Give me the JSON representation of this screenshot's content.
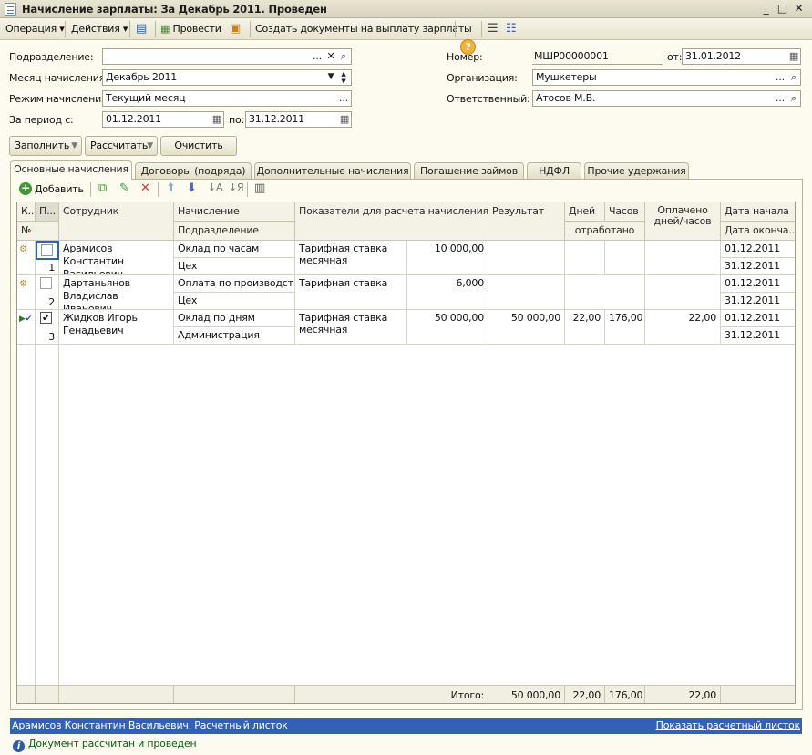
{
  "window": {
    "title": "Начисление зарплаты: За Декабрь 2011. Проведен"
  },
  "toolbar": {
    "operation": "Операция",
    "actions": "Действия",
    "post": "Провести",
    "create_payment": "Создать документы на выплату зарплаты"
  },
  "form": {
    "division_label": "Подразделение:",
    "division_value": "",
    "month_label": "Месяц начисления:",
    "month_value": "Декабрь 2011",
    "mode_label": "Режим начисления:",
    "mode_value": "Текущий месяц",
    "period_label": "За период с:",
    "period_from": "01.12.2011",
    "period_to_label": "по:",
    "period_to": "31.12.2011",
    "number_label": "Номер:",
    "number_value": "МШР00000001",
    "date_label": "от:",
    "date_value": "31.01.2012",
    "org_label": "Организация:",
    "org_value": "Мушкетеры",
    "resp_label": "Ответственный:",
    "resp_value": "Атосов М.В."
  },
  "commands": {
    "fill": "Заполнить",
    "calc": "Рассчитать",
    "clear": "Очистить"
  },
  "tabs": [
    "Основные начисления",
    "Договоры (подряда)",
    "Дополнительные начисления",
    "Погашение займов",
    "НДФЛ",
    "Прочие удержания"
  ],
  "grid_toolbar": {
    "add": "Добавить"
  },
  "columns": {
    "k": "К...",
    "p": "П...",
    "num": "№",
    "employee": "Сотрудник",
    "accrual": "Начисление",
    "division": "Подразделение",
    "indicators": "Показатели для расчета начисления",
    "result": "Результат",
    "days": "Дней",
    "hours": "Часов",
    "worked": "отработано",
    "paid": "Оплачено дней/часов",
    "start": "Дата начала",
    "end": "Дата оконча..."
  },
  "rows": [
    {
      "num": "1",
      "checked": "",
      "employee": "Арамисов Константин Васильевич",
      "accrual": "Оклад по часам",
      "division": "Цех",
      "indicator": "Тарифная ставка месячная",
      "ind_value": "10 000,00",
      "result": "",
      "days": "",
      "hours": "",
      "paid": "",
      "start": "01.12.2011",
      "end": "31.12.2011"
    },
    {
      "num": "2",
      "checked": "",
      "employee": "Дартаньянов Владислав Иванович",
      "accrual": "Оплата по производст...",
      "division": "Цех",
      "indicator": "Тарифная ставка",
      "ind_value": "6,000",
      "result": "",
      "days": "",
      "hours": "",
      "paid": "",
      "start": "01.12.2011",
      "end": "31.12.2011"
    },
    {
      "num": "3",
      "checked": "✔",
      "employee": "Жидков Игорь Генадьевич",
      "accrual": "Оклад по дням",
      "division": "Администрация",
      "indicator": "Тарифная ставка месячная",
      "ind_value": "50 000,00",
      "result": "50 000,00",
      "days": "22,00",
      "hours": "176,00",
      "paid": "22,00",
      "start": "01.12.2011",
      "end": "31.12.2011"
    }
  ],
  "footer": {
    "total_label": "Итого:",
    "result": "50 000,00",
    "days": "22,00",
    "hours": "176,00",
    "paid": "22,00"
  },
  "status": {
    "text": "Арамисов Константин Васильевич. Расчетный листок",
    "link": "Показать расчетный листок",
    "info": "Документ рассчитан и проведен"
  }
}
